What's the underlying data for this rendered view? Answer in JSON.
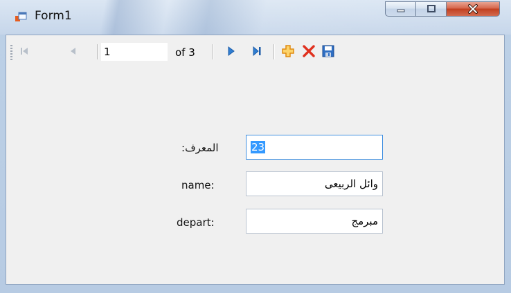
{
  "window": {
    "title": "Form1"
  },
  "navigator": {
    "position_value": "1",
    "count_label": "of 3",
    "buttons": {
      "move_first": "move-first-icon",
      "move_previous": "move-previous-icon",
      "move_next": "move-next-icon",
      "move_last": "move-last-icon",
      "add_new": "add-new-icon",
      "delete": "delete-icon",
      "save": "save-icon"
    }
  },
  "form": {
    "fields": [
      {
        "label": ":المعرف",
        "value": "23"
      },
      {
        "label": "name:",
        "value": "وائل الربيعى"
      },
      {
        "label": "depart:",
        "value": "مبرمج"
      }
    ]
  },
  "colors": {
    "selection": "#3399ff",
    "nav_blue": "#2f7dd1",
    "add_orange": "#f0a020",
    "delete_red": "#e0301e",
    "close_red": "#c8492a"
  }
}
